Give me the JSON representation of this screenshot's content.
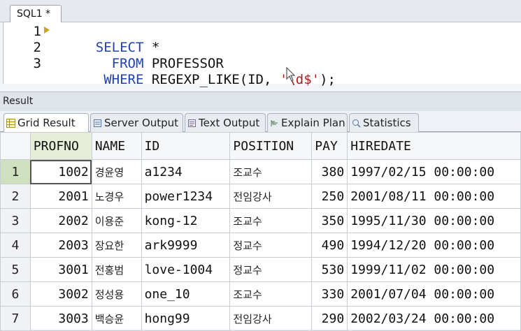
{
  "editor": {
    "tab_label": "SQL1 *",
    "lines": [
      {
        "number": "1",
        "segments": [
          {
            "text": "SELECT ",
            "kind": "kw"
          },
          {
            "text": "*",
            "kind": "plain"
          }
        ]
      },
      {
        "number": "2",
        "segments": [
          {
            "text": "  FROM ",
            "kind": "kw"
          },
          {
            "text": "PROFESSOR",
            "kind": "plain"
          }
        ]
      },
      {
        "number": "3",
        "segments": [
          {
            "text": " WHERE ",
            "kind": "kw"
          },
          {
            "text": "REGEXP_LIKE(ID, ",
            "kind": "plain"
          },
          {
            "text": "'\\d$'",
            "kind": "str"
          },
          {
            "text": ");",
            "kind": "plain"
          }
        ]
      }
    ]
  },
  "result": {
    "header_label": "Result",
    "tabs": [
      {
        "label": "Grid Result",
        "icon": "grid-result-icon",
        "active": true
      },
      {
        "label": "Server Output",
        "icon": "server-output-icon",
        "active": false
      },
      {
        "label": "Text Output",
        "icon": "text-output-icon",
        "active": false
      },
      {
        "label": "Explain Plan",
        "icon": "explain-plan-icon",
        "active": false
      },
      {
        "label": "Statistics",
        "icon": "statistics-icon",
        "active": false
      }
    ],
    "columns": [
      "PROFNO",
      "NAME",
      "ID",
      "POSITION",
      "PAY",
      "HIREDATE"
    ],
    "rows": [
      {
        "rownum": "1",
        "profno": "1002",
        "name": "경윤영",
        "id": "a1234",
        "position": "조교수",
        "pay": "380",
        "hiredate": "1997/02/15 00:00:00"
      },
      {
        "rownum": "2",
        "profno": "2001",
        "name": "노경우",
        "id": "power1234",
        "position": "전임강사",
        "pay": "250",
        "hiredate": "2001/08/11 00:00:00"
      },
      {
        "rownum": "3",
        "profno": "2002",
        "name": "이용준",
        "id": "kong-12",
        "position": "조교수",
        "pay": "350",
        "hiredate": "1995/11/30 00:00:00"
      },
      {
        "rownum": "4",
        "profno": "2003",
        "name": "장요한",
        "id": "ark9999",
        "position": "정교수",
        "pay": "490",
        "hiredate": "1994/12/20 00:00:00"
      },
      {
        "rownum": "5",
        "profno": "3001",
        "name": "전홍범",
        "id": "love-1004",
        "position": "정교수",
        "pay": "530",
        "hiredate": "1999/11/02 00:00:00"
      },
      {
        "rownum": "6",
        "profno": "3002",
        "name": "정성용",
        "id": "one_10",
        "position": "조교수",
        "pay": "330",
        "hiredate": "2001/07/04 00:00:00"
      },
      {
        "rownum": "7",
        "profno": "3003",
        "name": "백승윤",
        "id": "hong99",
        "position": "전임강사",
        "pay": "290",
        "hiredate": "2002/03/24 00:00:00"
      }
    ],
    "selected_row": "1"
  },
  "colors": {
    "keyword": "#1f3fb4",
    "string": "#b01c1c",
    "selected_row_header": "#cfe0bf",
    "sorted_column_header": "#e7eed7"
  }
}
